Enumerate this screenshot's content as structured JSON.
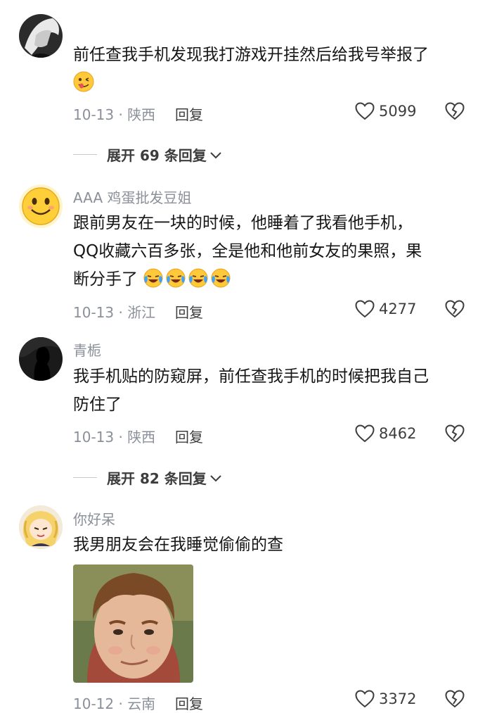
{
  "comments": [
    {
      "username": "",
      "text": "前任查我手机发现我打游戏开挂然后给我号举报了",
      "meta": "10-13 · 陕西",
      "reply": "回复",
      "likes": "5099",
      "expand": "展开 69 条回复"
    },
    {
      "username": "AAA 鸡蛋批发豆姐",
      "text_lines": [
        "跟前男友在一块的时候，他睡着了我看他手机，",
        "QQ收藏六百多张，全是他和他前女友的果照，果",
        "断分手了"
      ],
      "meta": "10-13 · 浙江",
      "reply": "回复",
      "likes": "4277"
    },
    {
      "username": "青栀",
      "text_lines": [
        "我手机贴的防窥屏，前任查我手机的时候把我自己",
        "防住了"
      ],
      "meta": "10-13 · 陕西",
      "reply": "回复",
      "likes": "8462",
      "expand": "展开 82 条回复"
    },
    {
      "username": "你好呆",
      "text": "我男朋友会在我睡觉偷偷的查",
      "meta": "10-12 · 云南",
      "reply": "回复",
      "likes": "3372"
    }
  ],
  "colors": {
    "secondary_text": "#8a8f99",
    "primary_text": "#161616",
    "icon": "#3d3d3d"
  }
}
